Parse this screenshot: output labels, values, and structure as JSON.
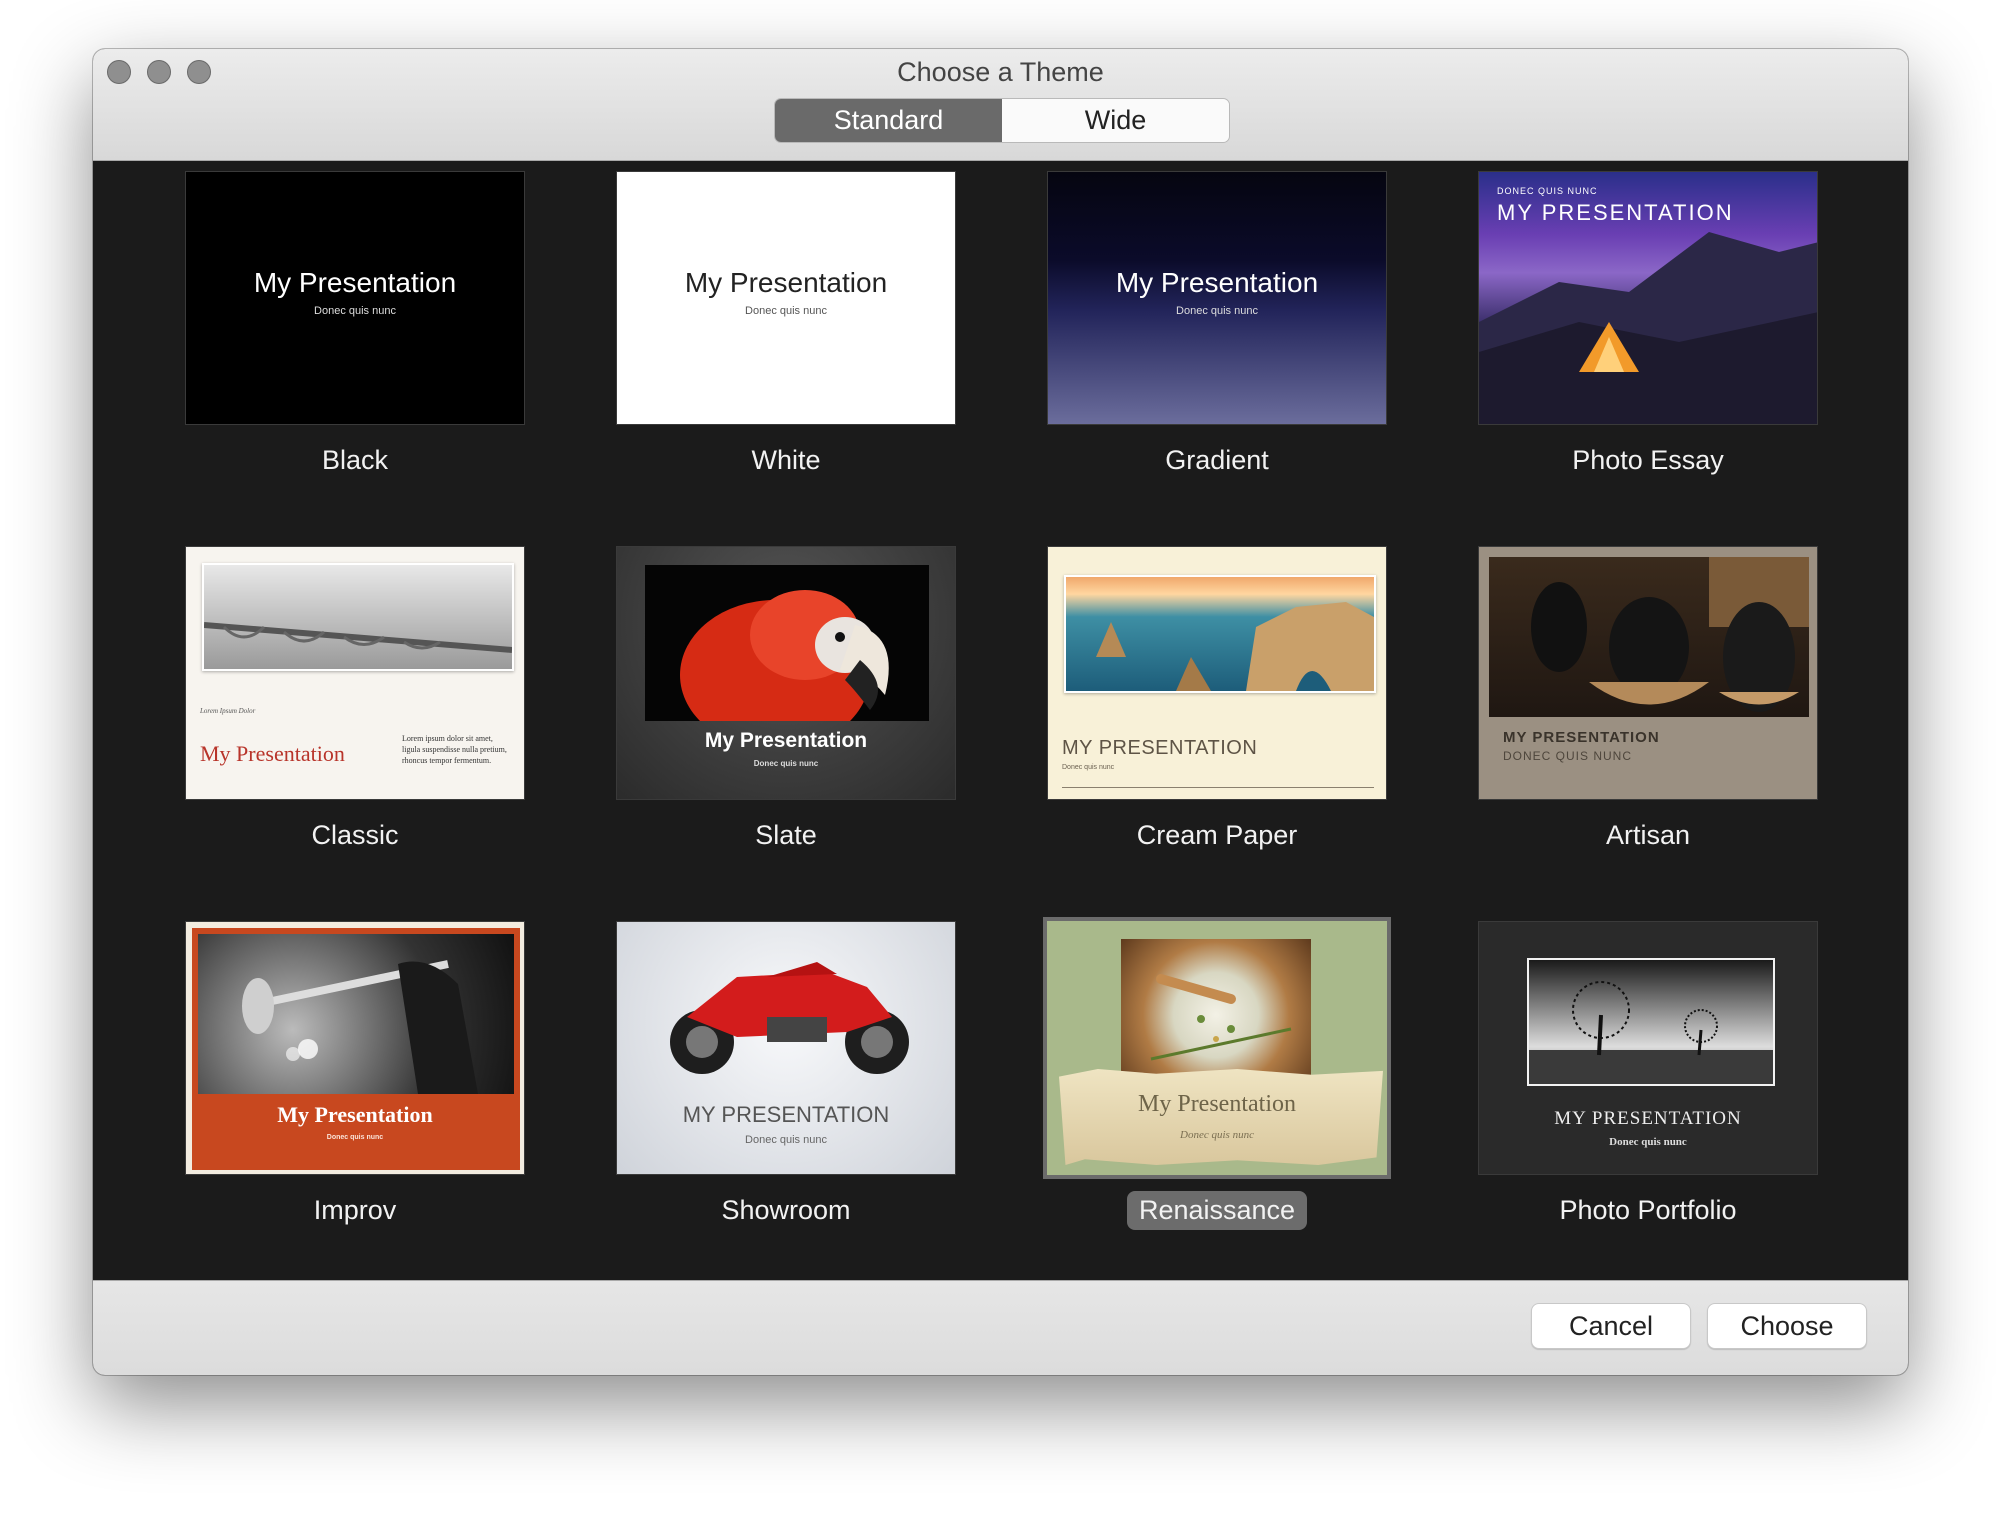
{
  "window": {
    "title": "Choose a Theme",
    "tabs": [
      {
        "label": "Standard",
        "active": true
      },
      {
        "label": "Wide",
        "active": false
      }
    ]
  },
  "themes": [
    {
      "name": "Black",
      "title": "My Presentation",
      "subtitle": "Donec quis nunc"
    },
    {
      "name": "White",
      "title": "My Presentation",
      "subtitle": "Donec quis nunc"
    },
    {
      "name": "Gradient",
      "title": "My Presentation",
      "subtitle": "Donec quis nunc"
    },
    {
      "name": "Photo Essay",
      "title": "MY PRESENTATION",
      "subtitle": "DONEC QUIS NUNC"
    },
    {
      "name": "Classic",
      "title": "My Presentation",
      "subtitle": "Lorem Ipsum Dolor",
      "body": "Lorem ipsum dolor sit amet, ligula suspendisse nulla pretium, rhoncus tempor fermentum."
    },
    {
      "name": "Slate",
      "title": "My Presentation",
      "subtitle": "Donec quis nunc"
    },
    {
      "name": "Cream Paper",
      "title": "MY PRESENTATION",
      "subtitle": "Donec quis nunc"
    },
    {
      "name": "Artisan",
      "title": "MY PRESENTATION",
      "subtitle": "DONEC QUIS NUNC"
    },
    {
      "name": "Improv",
      "title": "My Presentation",
      "subtitle": "Donec quis nunc"
    },
    {
      "name": "Showroom",
      "title": "MY PRESENTATION",
      "subtitle": "Donec quis nunc"
    },
    {
      "name": "Renaissance",
      "title": "My Presentation",
      "subtitle": "Donec quis nunc",
      "selected": true
    },
    {
      "name": "Photo Portfolio",
      "title": "MY PRESENTATION",
      "subtitle": "Donec quis nunc"
    }
  ],
  "footer": {
    "cancel_label": "Cancel",
    "choose_label": "Choose"
  },
  "colors": {
    "grid_background": "#1b1b1b",
    "selected_caption": "#6c6c6c",
    "classic_title": "#b8342a",
    "improv_banner": "#c8481f"
  }
}
